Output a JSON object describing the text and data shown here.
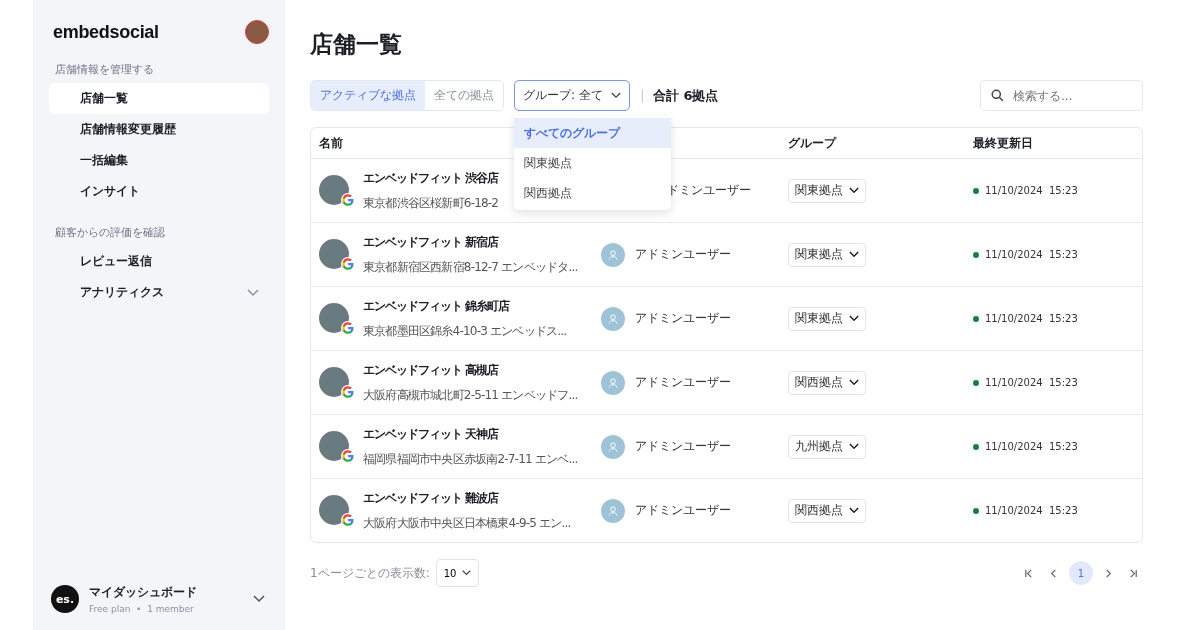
{
  "sidebar": {
    "logo": "embedsocial",
    "sections": [
      {
        "label": "店舗情報を管理する",
        "items": [
          {
            "label": "店舗一覧",
            "selected": true,
            "kind": "link"
          },
          {
            "label": "店舗情報変更履歴",
            "selected": false,
            "kind": "link"
          },
          {
            "label": "一括編集",
            "selected": false,
            "kind": "link"
          },
          {
            "label": "インサイト",
            "selected": false,
            "kind": "link"
          }
        ]
      },
      {
        "label": "顧客からの評価を確認",
        "items": [
          {
            "label": "レビュー返信",
            "selected": false,
            "kind": "link"
          },
          {
            "label": "アナリティクス",
            "selected": false,
            "kind": "group"
          }
        ]
      }
    ],
    "workspace": {
      "badge": "es.",
      "name": "マイダッシュボード",
      "plan": "Free plan  •  1 member"
    }
  },
  "page_title": "店舗一覧",
  "filter_tabs": [
    {
      "label": "アクティブな拠点",
      "selected": true
    },
    {
      "label": "全ての拠点",
      "selected": false
    }
  ],
  "group_select": {
    "value": "グループ: 全て",
    "open": true,
    "options": [
      {
        "label": "すべてのグループ",
        "selected": true
      },
      {
        "label": "関東拠点",
        "selected": false
      },
      {
        "label": "関西拠点",
        "selected": false
      }
    ]
  },
  "total": "合計 6拠点",
  "search": {
    "placeholder": "検索する..."
  },
  "table": {
    "columns": [
      "名前",
      "",
      "グループ",
      "最終更新日"
    ],
    "rows": [
      {
        "name": "エンベッドフィット 渋谷店",
        "address": "東京都渋谷区桜新町6-18-2",
        "user": "ドミンユーザー",
        "avatar": false,
        "group": "関東拠点",
        "updated": "11/10/2024  15:23",
        "color": "#1a7f3c"
      },
      {
        "name": "エンベッドフィット 新宿店",
        "address": "東京都新宿区西新宿8-12-7 エンベッドタ...",
        "user": "アドミンユーザー",
        "avatar": true,
        "group": "関東拠点",
        "updated": "11/10/2024  15:23",
        "color": "#1a7f3c"
      },
      {
        "name": "エンベッドフィット 錦糸町店",
        "address": "東京都墨田区錦糸4-10-3 エンベッドス...",
        "user": "アドミンユーザー",
        "avatar": true,
        "group": "関東拠点",
        "updated": "11/10/2024  15:23",
        "color": "#1a7f3c"
      },
      {
        "name": "エンベッドフィット 高槻店",
        "address": "大阪府高槻市城北町2-5-11 エンベッドフ...",
        "user": "アドミンユーザー",
        "avatar": true,
        "group": "関西拠点",
        "updated": "11/10/2024  15:23",
        "color": "#1a7f3c"
      },
      {
        "name": "エンベッドフィット 天神店",
        "address": "福岡県福岡市中央区赤坂南2-7-11 エンベ...",
        "user": "アドミンユーザー",
        "avatar": true,
        "group": "九州拠点",
        "updated": "11/10/2024  15:23",
        "color": "#1a7f3c"
      },
      {
        "name": "エンベッドフィット 難波店",
        "address": "大阪府大阪市中央区日本橋東4-9-5 エン...",
        "user": "アドミンユーザー",
        "avatar": true,
        "group": "関西拠点",
        "updated": "11/10/2024  15:23",
        "color": "#1a7f3c"
      }
    ]
  },
  "per_page": {
    "label": "1ページごとの表示数:",
    "value": "10"
  },
  "pages": [
    {
      "label": "1",
      "selected": true
    }
  ]
}
